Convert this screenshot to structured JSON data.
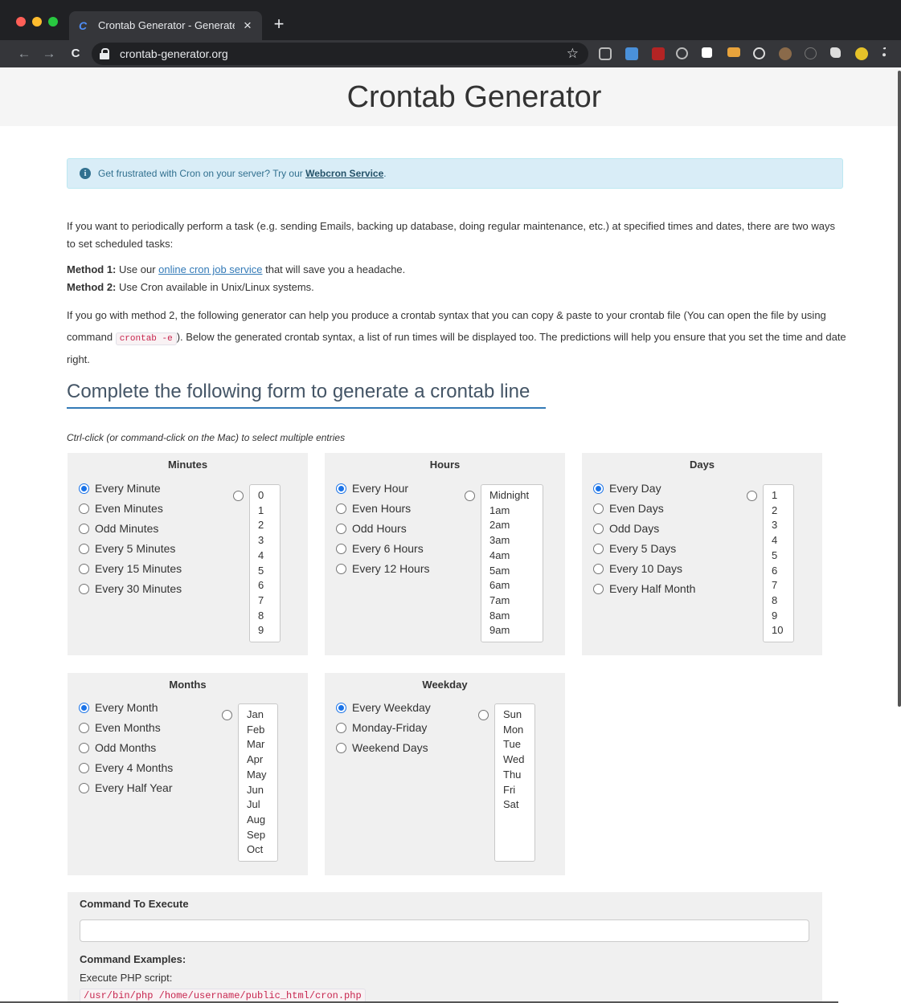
{
  "browser": {
    "tab_title": "Crontab Generator - Generate",
    "tab_close": "×",
    "new_tab": "+",
    "url": "crontab-generator.org",
    "back": "←",
    "forward": "→",
    "reload": "C",
    "bookmark": "☆"
  },
  "header": {
    "title": "Crontab Generator"
  },
  "alert": {
    "text": "Get frustrated with Cron on your server? Try our ",
    "link": "Webcron Service",
    "end": "."
  },
  "intro": {
    "p1": "If you want to periodically perform a task (e.g. sending Emails, backing up database, doing regular maintenance, etc.) at specified times and dates, there are two ways to set scheduled tasks:",
    "m1_label": "Method 1:",
    "m1_text": " Use our ",
    "m1_link": "online cron job service",
    "m1_end": " that will save you a headache.",
    "m2_label": "Method 2:",
    "m2_text": " Use Cron available in Unix/Linux systems.",
    "p3a": "If you go with method 2, the following generator can help you produce a crontab syntax that you can copy & paste to your crontab file (You can open the file by using command ",
    "p3_code": "crontab -e",
    "p3b": "). Below the generated crontab syntax, a list of run times will be displayed too. The predictions will help you ensure that you set the time and date right."
  },
  "form": {
    "title": "Complete the following form to generate a crontab line",
    "hint": "Ctrl-click (or command-click on the Mac) to select multiple entries"
  },
  "minutes": {
    "title": "Minutes",
    "options": [
      "Every Minute",
      "Even Minutes",
      "Odd Minutes",
      "Every 5 Minutes",
      "Every 15 Minutes",
      "Every 30 Minutes"
    ],
    "list": [
      "0",
      "1",
      "2",
      "3",
      "4",
      "5",
      "6",
      "7",
      "8",
      "9"
    ]
  },
  "hours": {
    "title": "Hours",
    "options": [
      "Every Hour",
      "Even Hours",
      "Odd Hours",
      "Every 6 Hours",
      "Every 12 Hours"
    ],
    "list": [
      "Midnight",
      "1am",
      "2am",
      "3am",
      "4am",
      "5am",
      "6am",
      "7am",
      "8am",
      "9am"
    ]
  },
  "days": {
    "title": "Days",
    "options": [
      "Every Day",
      "Even Days",
      "Odd Days",
      "Every 5 Days",
      "Every 10 Days",
      "Every Half Month"
    ],
    "list": [
      "1",
      "2",
      "3",
      "4",
      "5",
      "6",
      "7",
      "8",
      "9",
      "10"
    ]
  },
  "months": {
    "title": "Months",
    "options": [
      "Every Month",
      "Even Months",
      "Odd Months",
      "Every 4 Months",
      "Every Half Year"
    ],
    "list": [
      "Jan",
      "Feb",
      "Mar",
      "Apr",
      "May",
      "Jun",
      "Jul",
      "Aug",
      "Sep",
      "Oct"
    ]
  },
  "weekday": {
    "title": "Weekday",
    "options": [
      "Every Weekday",
      "Monday-Friday",
      "Weekend Days"
    ],
    "list": [
      "Sun",
      "Mon",
      "Tue",
      "Wed",
      "Thu",
      "Fri",
      "Sat"
    ]
  },
  "command": {
    "label": "Command To Execute",
    "value": "",
    "examples_label": "Command Examples:",
    "example_1": "Execute PHP script:",
    "example_1_code": "/usr/bin/php /home/username/public_html/cron.php"
  },
  "colors": {
    "accent": "#337ab7",
    "radio": "#1a73e8",
    "alert_bg": "#d9edf7",
    "panel_bg": "#f0f0f0"
  }
}
